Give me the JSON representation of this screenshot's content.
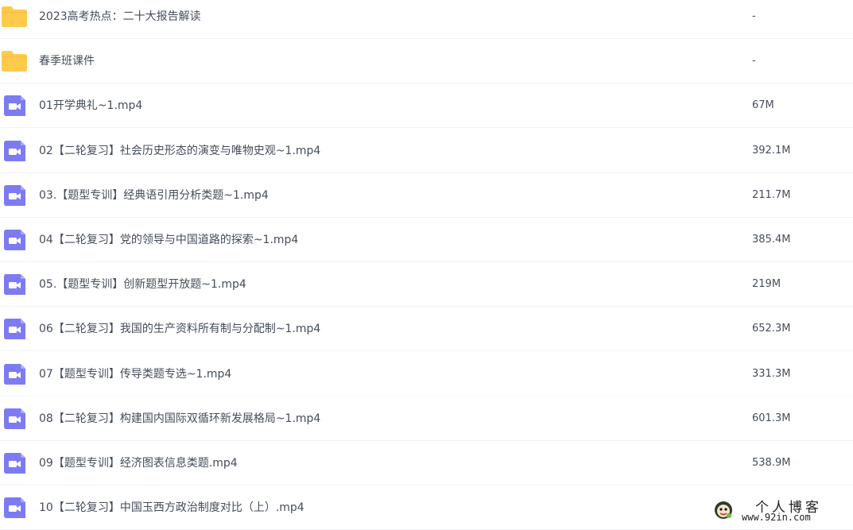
{
  "colors": {
    "folder": "#ffc94b",
    "video": "#7c7bf2",
    "text": "#454d5a",
    "divider": "#f1f2f4"
  },
  "files": [
    {
      "type": "folder",
      "icon": "folder-icon",
      "name": "2023高考热点：二十大报告解读",
      "size": "-"
    },
    {
      "type": "folder",
      "icon": "folder-icon",
      "name": "春季班课件",
      "size": "-"
    },
    {
      "type": "video",
      "icon": "video-file-icon",
      "name": "01开学典礼~1.mp4",
      "size": "67M"
    },
    {
      "type": "video",
      "icon": "video-file-icon",
      "name": "02【二轮复习】社会历史形态的演变与唯物史观~1.mp4",
      "size": "392.1M"
    },
    {
      "type": "video",
      "icon": "video-file-icon",
      "name": "03.【题型专训】经典语引用分析类题~1.mp4",
      "size": "211.7M"
    },
    {
      "type": "video",
      "icon": "video-file-icon",
      "name": "04【二轮复习】党的领导与中国道路的探索~1.mp4",
      "size": "385.4M"
    },
    {
      "type": "video",
      "icon": "video-file-icon",
      "name": "05.【题型专训】创新题型开放题~1.mp4",
      "size": "219M"
    },
    {
      "type": "video",
      "icon": "video-file-icon",
      "name": "06【二轮复习】我国的生产资料所有制与分配制~1.mp4",
      "size": "652.3M"
    },
    {
      "type": "video",
      "icon": "video-file-icon",
      "name": "07【题型专训】传导类题专选~1.mp4",
      "size": "331.3M"
    },
    {
      "type": "video",
      "icon": "video-file-icon",
      "name": "08【二轮复习】构建国内国际双循环新发展格局~1.mp4",
      "size": "601.3M"
    },
    {
      "type": "video",
      "icon": "video-file-icon",
      "name": "09【题型专训】经济图表信息类题.mp4",
      "size": "538.9M"
    },
    {
      "type": "video",
      "icon": "video-file-icon",
      "name": "10【二轮复习】中国玉西方政治制度对比（上）.mp4",
      "size": ""
    }
  ],
  "watermark": {
    "title": "个人博客",
    "url": "www.92in.com"
  }
}
